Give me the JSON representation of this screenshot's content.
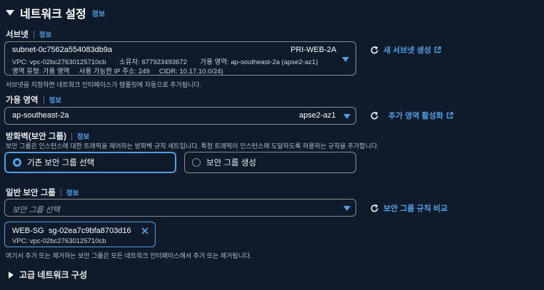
{
  "section": {
    "title": "네트워크 설정",
    "info": "정보"
  },
  "subnet": {
    "label": "서브넷",
    "info": "정보",
    "id": "subnet-0c7562a554083db9a",
    "name": "PRI-WEB-2A",
    "line2": "VPC: vpc-02bc27630125710cb       소유자: 677923493672       가용 영역: ap-southeast-2a (apse2-az1)",
    "line3": "영역 유형: 가용 영역     사용 가능한 IP 주소: 249     CIDR: 10.17.10.0/24)",
    "create_link": "새 서브넷 생성",
    "hint": "서브넷을 지정하면 네트워크 인터페이스가 템플릿에 자동으로 추가됩니다."
  },
  "az": {
    "label": "가용 영역",
    "info": "정보",
    "value": "ap-southeast-2a",
    "id": "apse2-az1",
    "add_link": "추가 영역 활성화"
  },
  "firewall": {
    "label": "방화벽(보안 그룹)",
    "info": "정보",
    "description": "보안 그룹은 인스턴스에 대한 트래픽을 제어하는 방화벽 규칙 세트입니다. 특정 트래픽이 인스턴스에 도달하도록 허용하는 규칙을 추가합니다.",
    "options": [
      "기존 보안 그룹 선택",
      "보안 그룹 생성"
    ],
    "selected": 0
  },
  "sg": {
    "label": "일반 보안 그룹",
    "info": "정보",
    "placeholder": "보안 그룹 선택",
    "compare_link": "보안 그룹 규칙 비교",
    "token_name": "WEB-SG",
    "token_id": "sg-02ea7c9bfa8703d16",
    "token_vpc": "VPC: vpc-02bc27630125710cb",
    "hint": "여기서 추가 또는 제거하는 보안 그룹은 모든 네트워크 인터페이스에서 추가 또는 제거됩니다."
  },
  "advanced": {
    "label": "고급 네트워크 구성"
  },
  "colors": {
    "background": "#0f1b2a",
    "accent": "#539fe5",
    "border": "#8c8c94"
  }
}
